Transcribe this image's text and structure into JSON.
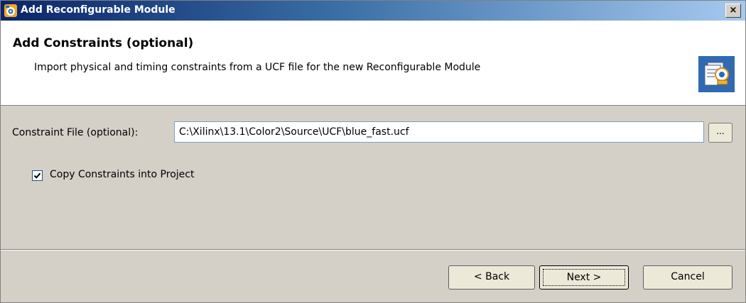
{
  "window": {
    "title": "Add Reconfigurable Module",
    "close_label": "×",
    "app_icon": "xilinx-app-icon"
  },
  "header": {
    "title": "Add Constraints (optional)",
    "subtitle": "Import physical and timing constraints from a UCF file for the new Reconfigurable Module",
    "icon": "document-wizard-icon"
  },
  "form": {
    "constraint_label": "Constraint File (optional):",
    "constraint_value": "C:\\Xilinx\\13.1\\Color2\\Source\\UCF\\blue_fast.ucf",
    "browse_label": "...",
    "copy_checkbox_label": "Copy Constraints into Project",
    "copy_checked": true
  },
  "buttons": {
    "back": "< Back",
    "next": "Next >",
    "cancel": "Cancel"
  }
}
